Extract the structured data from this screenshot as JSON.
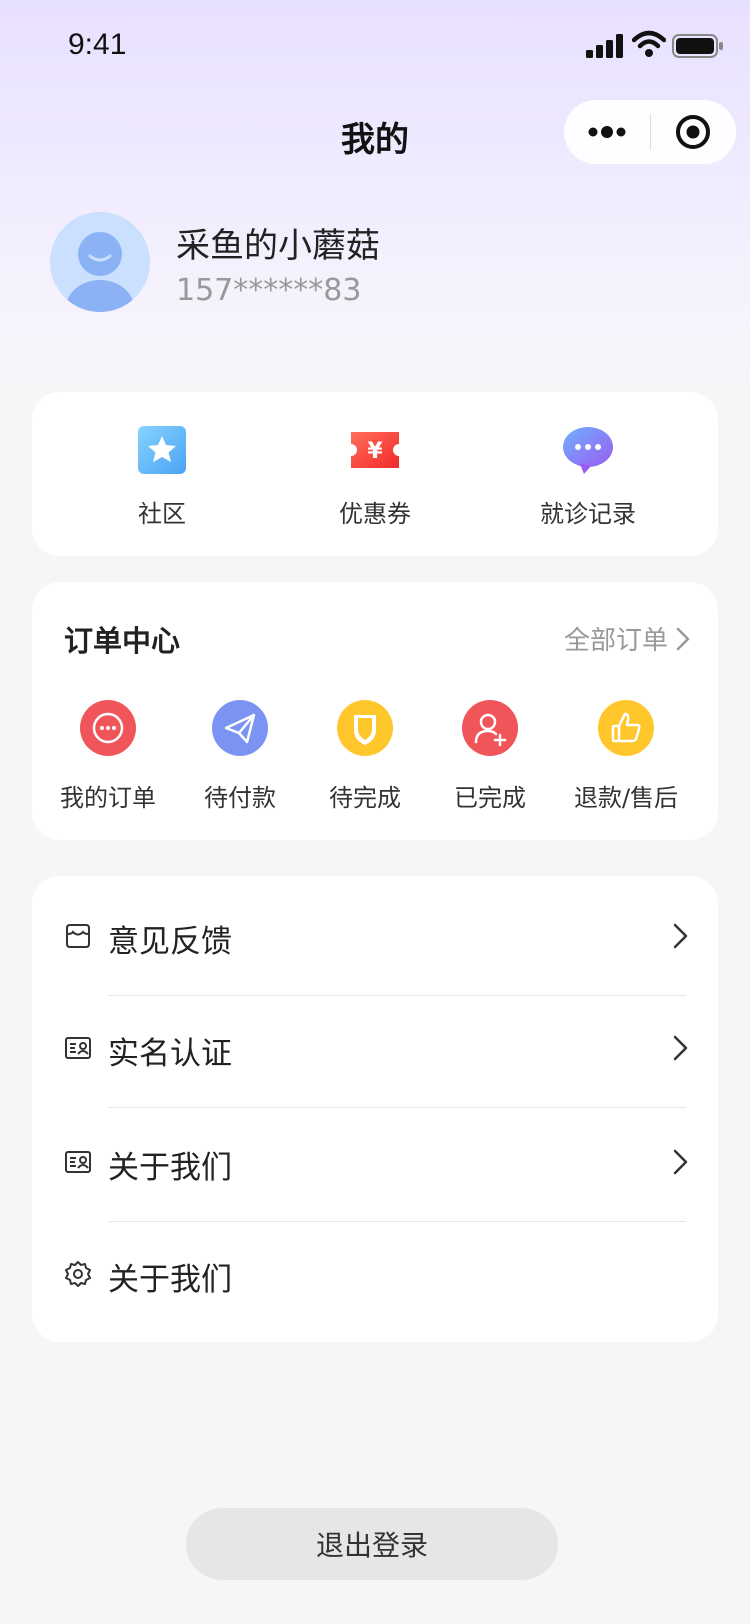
{
  "status_bar": {
    "time": "9:41"
  },
  "nav": {
    "title": "我的"
  },
  "user": {
    "name": "采鱼的小蘑菇",
    "phone": "157******83"
  },
  "quick_links": [
    {
      "label": "社区",
      "icon": "star-card-icon"
    },
    {
      "label": "优惠券",
      "icon": "coupon-yen-icon"
    },
    {
      "label": "就诊记录",
      "icon": "chat-bubble-icon"
    }
  ],
  "orders": {
    "title": "订单中心",
    "all_label": "全部订单",
    "items": [
      {
        "label": "我的订单",
        "icon": "message-icon",
        "color": "#f0555a"
      },
      {
        "label": "待付款",
        "icon": "paper-plane-icon",
        "color": "#7b93f2"
      },
      {
        "label": "待完成",
        "icon": "shield-icon",
        "color": "#ffc72c"
      },
      {
        "label": "已完成",
        "icon": "user-add-icon",
        "color": "#f0555a"
      },
      {
        "label": "退款/售后",
        "icon": "thumbs-up-icon",
        "color": "#ffc72c"
      }
    ]
  },
  "menu": [
    {
      "label": "意见反馈",
      "icon": "feedback-box-icon",
      "has_arrow": true
    },
    {
      "label": "实名认证",
      "icon": "id-card-icon",
      "has_arrow": true
    },
    {
      "label": "关于我们",
      "icon": "id-card-icon",
      "has_arrow": true
    },
    {
      "label": "关于我们",
      "icon": "settings-gear-icon",
      "has_arrow": false
    }
  ],
  "logout": {
    "label": "退出登录"
  },
  "colors": {
    "accent_bg": "#e8e0ff",
    "card_bg": "#ffffff",
    "page_bg": "#f6f6f6"
  }
}
